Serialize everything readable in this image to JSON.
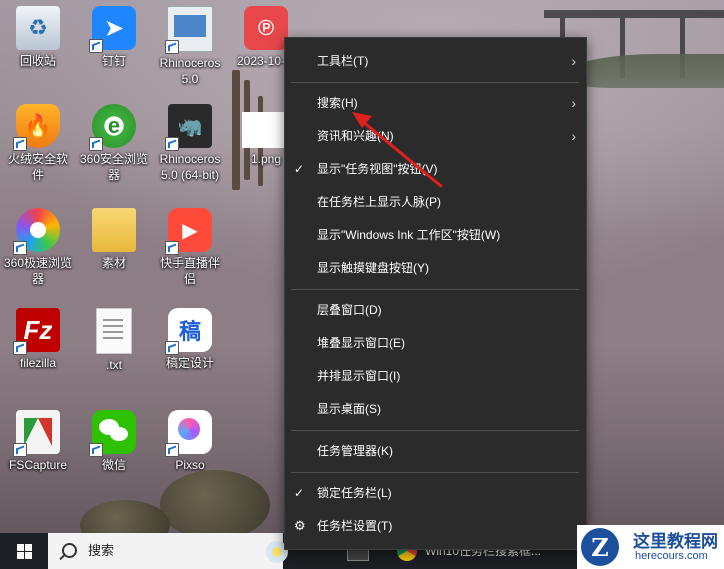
{
  "desktop": {
    "icons": [
      {
        "label": "回收站"
      },
      {
        "label": "钉钉"
      },
      {
        "label": "Rhinoceros 5.0"
      },
      {
        "label": "2023-10-..."
      },
      {
        "label": "火绒安全软件"
      },
      {
        "label": "360安全浏览器"
      },
      {
        "label": "Rhinoceros 5.0 (64-bit)"
      },
      {
        "label": "1.png"
      },
      {
        "label": "360极速浏览器"
      },
      {
        "label": "素材"
      },
      {
        "label": "快手直播伴侣"
      },
      {
        "label": "filezilla"
      },
      {
        "label": ".txt"
      },
      {
        "label": "稿定设计"
      },
      {
        "label": "FSCapture"
      },
      {
        "label": "微信"
      },
      {
        "label": "Pixso"
      }
    ]
  },
  "context_menu": {
    "items": [
      {
        "label": "工具栏(T)",
        "submenu": "›"
      },
      {
        "label": "搜索(H)",
        "submenu": "›"
      },
      {
        "label": "资讯和兴趣(N)",
        "submenu": "›"
      },
      {
        "label": "显示\"任务视图\"按钮(V)",
        "check": "✓"
      },
      {
        "label": "在任务栏上显示人脉(P)"
      },
      {
        "label": "显示\"Windows Ink 工作区\"按钮(W)"
      },
      {
        "label": "显示触摸键盘按钮(Y)"
      },
      {
        "label": "层叠窗口(D)"
      },
      {
        "label": "堆叠显示窗口(E)"
      },
      {
        "label": "并排显示窗口(I)"
      },
      {
        "label": "显示桌面(S)"
      },
      {
        "label": "任务管理器(K)"
      },
      {
        "label": "锁定任务栏(L)",
        "check": "✓"
      },
      {
        "label": "任务栏设置(T)",
        "icon": "gear-icon"
      }
    ]
  },
  "taskbar": {
    "search_label": "搜索",
    "window_title": "Win10任务栏搜索框..."
  },
  "watermark": {
    "logo_letter": "Z",
    "title": "这里教程网",
    "url": "herecours.com"
  },
  "colors": {
    "menu_bg": "#2b2b2b",
    "menu_text": "#ffffff",
    "arrow": "#e0201c",
    "taskbar": "#1c1f23",
    "watermark_blue": "#1c4f9c"
  }
}
